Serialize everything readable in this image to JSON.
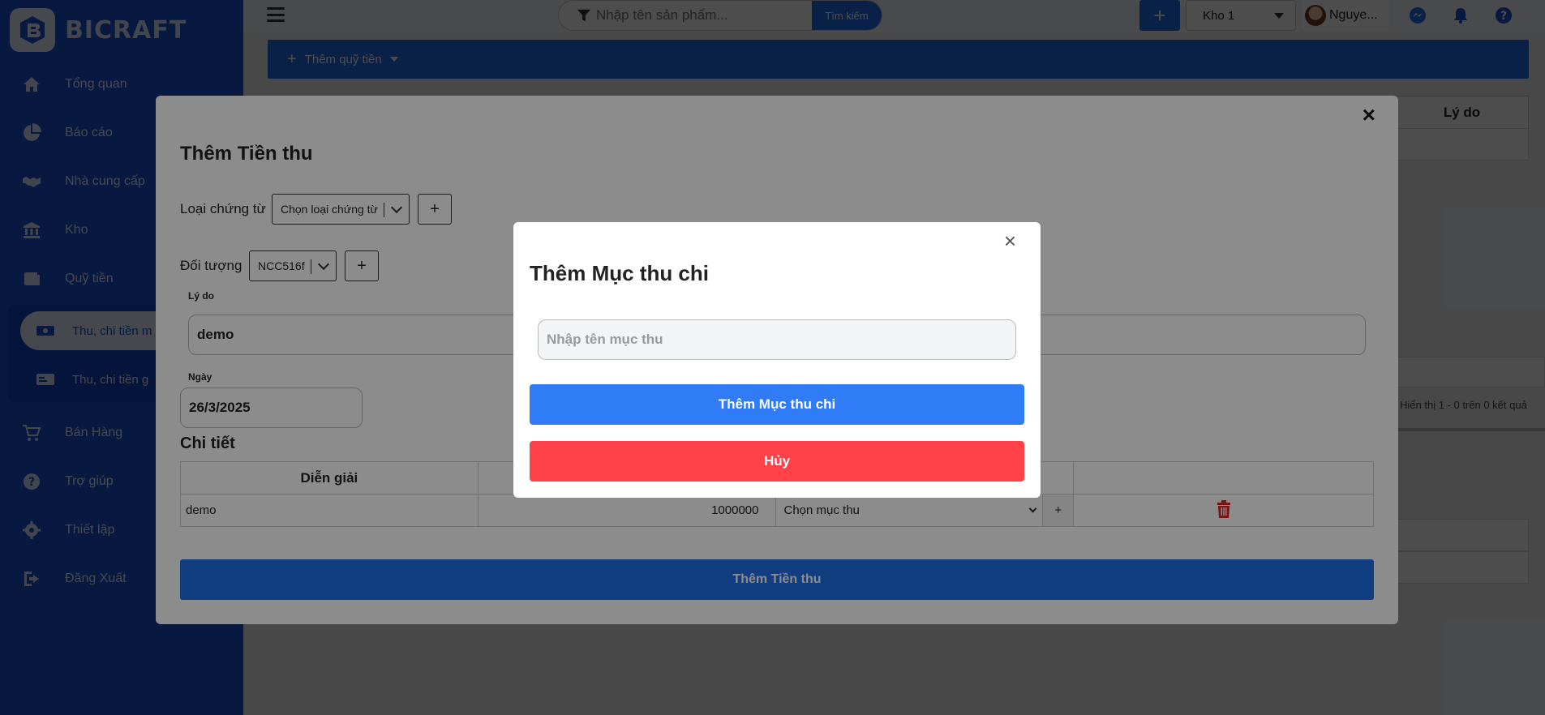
{
  "app": {
    "brand": "BICRAFT"
  },
  "topbar": {
    "search_placeholder": "Nhập tên sản phẩm...",
    "search_button": "Tìm kiếm",
    "add_button": "+",
    "warehouse": "Kho 1",
    "user_name": "Nguye..."
  },
  "sidebar": {
    "items": [
      {
        "label": "Tổng quan",
        "icon": "home-icon"
      },
      {
        "label": "Báo cáo",
        "icon": "pie-chart-icon"
      },
      {
        "label": "Nhà cung cấp",
        "icon": "handshake-icon"
      },
      {
        "label": "Kho",
        "icon": "bank-icon"
      },
      {
        "label": "Quỹ tiền",
        "icon": "wallet-icon"
      },
      {
        "label": "Bán Hàng",
        "icon": "cart-icon"
      },
      {
        "label": "Trợ giúp",
        "icon": "help-icon"
      },
      {
        "label": "Thiết lập",
        "icon": "gear-icon"
      },
      {
        "label": "Đăng Xuất",
        "icon": "logout-icon"
      }
    ],
    "sub_items": [
      {
        "label": "Thu, chi tiền m",
        "icon": "money-icon",
        "active": true
      },
      {
        "label": "Thu, chi tiền g",
        "icon": "card-icon",
        "active": false
      }
    ]
  },
  "page": {
    "add_fund_button": "Thêm quỹ tiền",
    "table_header_reason": "Lý do",
    "pager_text": "Hiển thị 1 - 0 trên 0 kết quả"
  },
  "modal_income": {
    "title": "Thêm Tiền thu",
    "doc_type_label": "Loại chứng từ",
    "doc_type_value": "Chọn loại chứng từ",
    "object_label": "Đối tượng",
    "object_value": "NCC516f",
    "reason_label": "Lý do",
    "reason_value": "demo",
    "date_label": "Ngày",
    "date_value": "26/3/2025",
    "detail_title": "Chi tiết",
    "detail_header_desc": "Diễn giải",
    "detail_rows": [
      {
        "desc": "demo",
        "amount": "1000000",
        "category": "Chọn mục thu"
      }
    ],
    "submit_button": "Thêm Tiền thu",
    "plus": "+",
    "close": "×"
  },
  "modal_category": {
    "title": "Thêm Mục thu chi",
    "input_placeholder": "Nhập tên mục thu",
    "add_button": "Thêm Mục thu chi",
    "cancel_button": "Hủy",
    "close": "×"
  },
  "colors": {
    "sidebar": "#1a54d6",
    "primary": "#1f6feb",
    "danger": "#ff4249",
    "trash": "#e02424"
  }
}
